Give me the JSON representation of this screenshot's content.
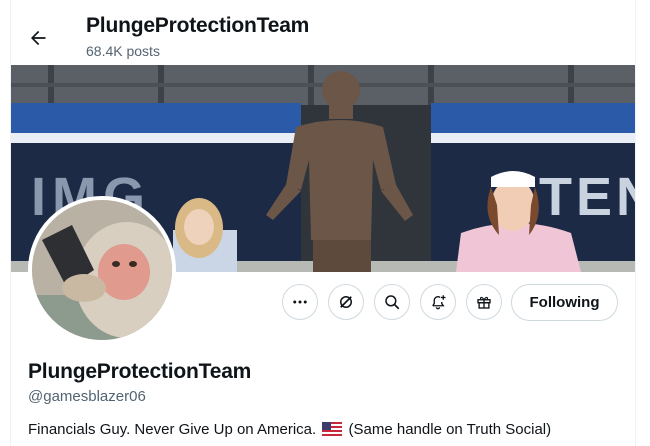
{
  "header": {
    "title": "PlungeProtectionTeam",
    "post_count": "68.4K posts"
  },
  "banner": {
    "sign_left": "IMG",
    "sign_right": "TEN"
  },
  "actions": {
    "more_icon": "more-icon",
    "grok_icon": "grok-icon",
    "search_icon": "search-icon",
    "notify_icon": "bell-plus-icon",
    "subscribe_icon": "gift-icon",
    "follow_label": "Following"
  },
  "profile": {
    "display_name": "PlungeProtectionTeam",
    "handle": "@gamesblazer06",
    "bio_before_flag": "Financials Guy. Never Give Up on America.",
    "bio_after_flag": "(Same handle on Truth Social)"
  },
  "colors": {
    "text_primary": "#0f1419",
    "text_secondary": "#536471",
    "border": "#cfd9de"
  }
}
